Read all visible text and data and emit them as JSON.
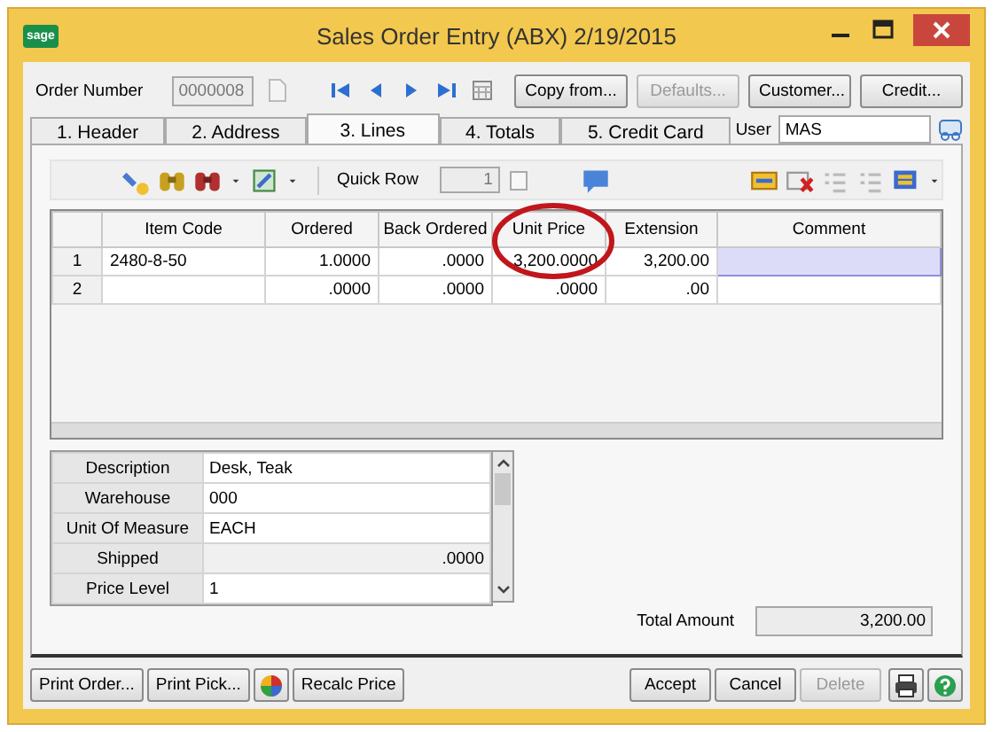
{
  "window": {
    "logo": "sage",
    "title": "Sales Order Entry (ABX) 2/19/2015"
  },
  "header": {
    "order_label": "Order Number",
    "order_number": "0000008",
    "buttons": [
      {
        "label": "Copy from...",
        "disabled": false
      },
      {
        "label": "Defaults...",
        "disabled": true
      },
      {
        "label": "Customer...",
        "disabled": false
      },
      {
        "label": "Credit...",
        "disabled": false
      }
    ]
  },
  "tabs": [
    {
      "label": "1. Header",
      "selected": false
    },
    {
      "label": "2. Address",
      "selected": false
    },
    {
      "label": "3. Lines",
      "selected": true
    },
    {
      "label": "4. Totals",
      "selected": false
    },
    {
      "label": "5. Credit Card",
      "selected": false
    }
  ],
  "user": {
    "label": "User",
    "value": "MAS"
  },
  "toolbar": {
    "quick_row_label": "Quick Row",
    "quick_row_value": "1"
  },
  "table": {
    "columns": [
      "Item Code",
      "Ordered",
      "Back Ordered",
      "Unit Price",
      "Extension",
      "Comment"
    ],
    "rows": [
      {
        "number": "1",
        "cells": [
          "2480-8-50",
          "1.0000",
          ".0000",
          "3,200.0000",
          "3,200.00",
          ""
        ],
        "selected": true
      },
      {
        "number": "2",
        "cells": [
          "",
          ".0000",
          ".0000",
          ".0000",
          ".00",
          ""
        ],
        "selected": false
      }
    ]
  },
  "details": [
    {
      "label": "Description",
      "value": "Desk, Teak",
      "readonly": false
    },
    {
      "label": "Warehouse",
      "value": "000",
      "readonly": false
    },
    {
      "label": "Unit Of Measure",
      "value": "EACH",
      "readonly": false
    },
    {
      "label": "Shipped",
      "value": ".0000",
      "readonly": true
    },
    {
      "label": "Price Level",
      "value": "1",
      "readonly": false
    }
  ],
  "total": {
    "label": "Total Amount",
    "value": "3,200.00"
  },
  "bottom_buttons": [
    {
      "label": "Print Order...",
      "kind": "text"
    },
    {
      "label": "Print Pick...",
      "kind": "text"
    },
    {
      "kind": "icon"
    },
    {
      "label": "Recalc Price",
      "kind": "text"
    }
  ],
  "action_buttons": [
    {
      "label": "Accept",
      "disabled": false
    },
    {
      "label": "Cancel",
      "disabled": false
    },
    {
      "label": "Delete",
      "disabled": true
    }
  ]
}
